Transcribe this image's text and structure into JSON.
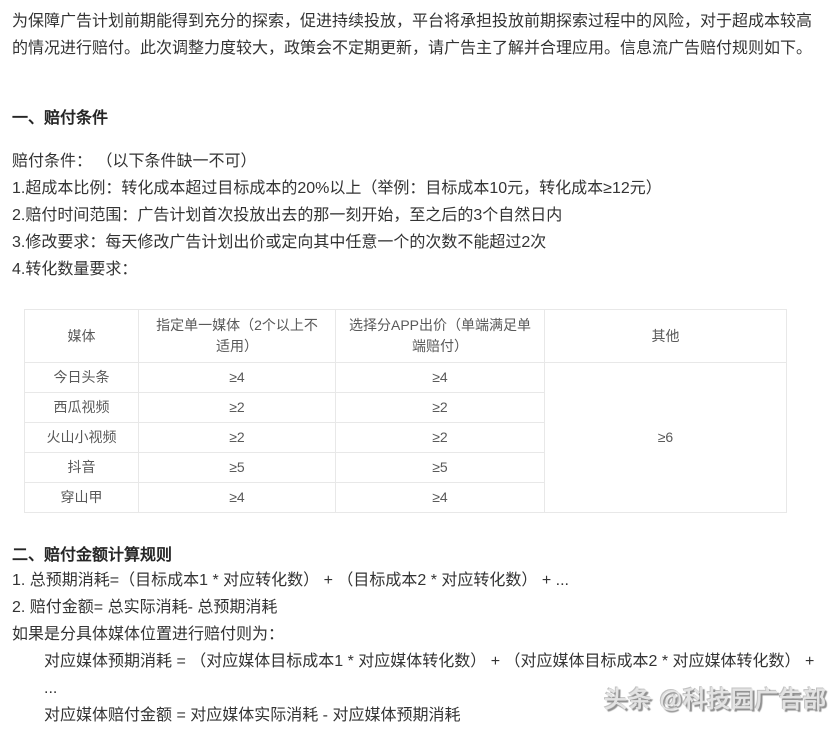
{
  "colors": {
    "body_text": "#333333",
    "table_text": "#595959",
    "table_border": "#e8e8e8",
    "watermark": "#bfbfbf"
  },
  "intro": {
    "lines": [
      "为保障广告计划前期能得到充分的探索，促进持续投放，平台将承担投放前期探索过程中的风险，对于超成本较高",
      "的情况进行赔付。此次调整力度较大，政策会不定期更新，请广告主了解并合理应用。信息流广告赔付规则如下。"
    ]
  },
  "section1": {
    "title": "一、赔付条件",
    "intro": "赔付条件： （以下条件缺一不可）",
    "items": [
      "1.超成本比例：转化成本超过目标成本的20%以上（举例：目标成本10元，转化成本≥12元）",
      "2.赔付时间范围：广告计划首次投放出去的那一刻开始，至之后的3个自然日内",
      "3.修改要求：每天修改广告计划出价或定向其中任意一个的次数不能超过2次",
      "4.转化数量要求："
    ]
  },
  "table": {
    "headers": [
      "媒体",
      "指定单一媒体（2个以上不适用）",
      "选择分APP出价（单端满足单端赔付）",
      "其他"
    ],
    "rows": [
      {
        "media": "今日头条",
        "single": "≥4",
        "app": "≥4"
      },
      {
        "media": "西瓜视频",
        "single": "≥2",
        "app": "≥2"
      },
      {
        "media": "火山小视频",
        "single": "≥2",
        "app": "≥2"
      },
      {
        "media": "抖音",
        "single": "≥5",
        "app": "≥5"
      },
      {
        "media": "穿山甲",
        "single": "≥4",
        "app": "≥4"
      }
    ],
    "other": "≥6"
  },
  "section2": {
    "title": "二、赔付金额计算规则",
    "lines": [
      "1. 总预期消耗=（目标成本1 * 对应转化数） + （目标成本2 * 对应转化数） + ...",
      "2. 赔付金额= 总实际消耗- 总预期消耗",
      "如果是分具体媒体位置进行赔付则为：",
      "对应媒体预期消耗 = （对应媒体目标成本1 * 对应媒体转化数） + （对应媒体目标成本2 * 对应媒体转化数） +",
      "...",
      "对应媒体赔付金额 = 对应媒体实际消耗 - 对应媒体预期消耗"
    ]
  },
  "watermark": {
    "text": "头条 @科技园广告部"
  }
}
